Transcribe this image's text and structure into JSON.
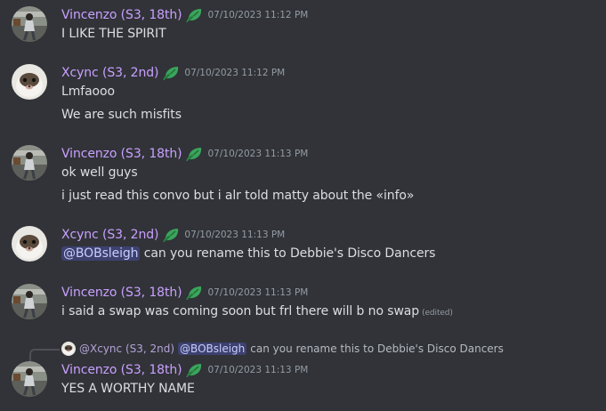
{
  "users": {
    "vincenzo": "Vincenzo (S3, 18th)",
    "xcync": "Xcync (S3, 2nd)"
  },
  "messages": [
    {
      "author": "Vincenzo (S3, 18th)",
      "timestamp": "07/10/2023 11:12 PM",
      "lines": [
        "I LIKE THE SPIRIT"
      ]
    },
    {
      "author": "Xcync (S3, 2nd)",
      "timestamp": "07/10/2023 11:12 PM",
      "lines": [
        "Lmfaooo",
        "We are such misfits"
      ]
    },
    {
      "author": "Vincenzo (S3, 18th)",
      "timestamp": "07/10/2023 11:13 PM",
      "lines": [
        "ok well guys",
        "i just read this convo but i alr told matty about the «info»"
      ]
    },
    {
      "author": "Xcync (S3, 2nd)",
      "timestamp": "07/10/2023 11:13 PM",
      "mention": "@BOBsleigh",
      "text": " can you rename this to Debbie's Disco Dancers"
    },
    {
      "author": "Vincenzo (S3, 18th)",
      "timestamp": "07/10/2023 11:13 PM",
      "text": "i said a swap was coming soon but frl there will b no swap",
      "edited": "(edited)"
    },
    {
      "reply": {
        "author": "@Xcync (S3, 2nd)",
        "mention": "@BOBsleigh",
        "text": "can you rename this to Debbie's Disco Dancers"
      },
      "author": "Vincenzo (S3, 18th)",
      "timestamp": "07/10/2023 11:13 PM",
      "lines": [
        "YES A WORTHY NAME"
      ]
    }
  ],
  "icons": {
    "badge": "leaf-badge-icon",
    "avatar_v": "runner-avatar",
    "avatar_x": "ferret-avatar"
  },
  "colors": {
    "background": "#313338",
    "username": "#c9a0ff",
    "badge": "#3ba55c",
    "mention_bg": "#3c4270"
  }
}
